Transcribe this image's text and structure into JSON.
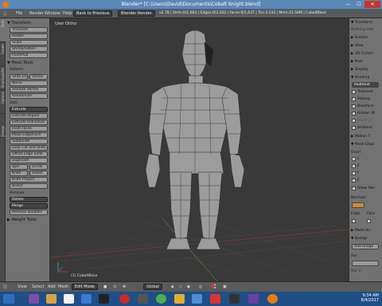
{
  "window": {
    "title": "Blender* [C:\\Users\\David\\Documents\\Cobalt Knight.blend]",
    "min": "—",
    "max": "☐",
    "close": "✕"
  },
  "infobar": {
    "menus": [
      "File",
      "Render",
      "Window",
      "Help"
    ],
    "back": "Back to Previous",
    "engine": "Blender Render",
    "stats": "v2.78 | Verts:0/1,663 | Edges:0/3,302 | Faces:0/1,637 | Tris:3,143 | Mem:21.56M | CobaltBase"
  },
  "left_tabs": [
    "Tools",
    "Create",
    "Shading/UVs",
    "Options",
    "Grease Pencil"
  ],
  "toolshelf": {
    "transform_header": "▼ Transform",
    "transform": [
      "Translate",
      "Rotate",
      "Scale",
      "Shrink/Fatten",
      "Push/Pull"
    ],
    "mesh_tools_header": "▼ Mesh Tools",
    "deform_label": "Deform:",
    "slide": [
      "Slide Ed",
      "Vertex"
    ],
    "deform": [
      "Noise",
      "Smooth Vertex",
      "Randomize"
    ],
    "add_label": "Add:",
    "extrude_select": "Extrude",
    "add": [
      "Extrude Region",
      "Extrude Individual",
      "Inset Faces",
      "Make Edge/Face",
      "Subdivide",
      "Loop Cut and Slide",
      "Offset Edge Slide",
      "Duplicate"
    ],
    "spin_screw": [
      "Spin",
      "Screw"
    ],
    "knife_select": [
      "Knife",
      "Select"
    ],
    "more": [
      "Knife Project",
      "Bisect"
    ],
    "remove_label": "Remove:",
    "delete_select": "Delete",
    "merge_select": "Merge",
    "remove_doubles": "Remove Doubles",
    "weight_tools": "▶ Weight Tools"
  },
  "viewport": {
    "title": "User Ortho",
    "object": "(1) CobaltBase"
  },
  "props": {
    "items": [
      "▼ Transform",
      "Nothing sele",
      "▶ Grease",
      "▶ View",
      "▶ 3D Cursor",
      "▶ Item",
      "▶ Display",
      "▼ Shading"
    ],
    "shading_select": "Multitext",
    "shading_checks": [
      "Textured",
      "Matcap",
      "Backface",
      "Hidden W",
      "Depth O",
      "Ambient"
    ],
    "motion": "▶ Motion T",
    "mesh_display": "▼ Mesh Displ",
    "overlay": "Overl",
    "overlay_checks": [
      "E",
      "E",
      "F",
      "E"
    ],
    "show_wei": "Show Wei",
    "normals": "Normals:",
    "edge_info": [
      "Edge",
      "Face"
    ],
    "mesh_an": "▶ Mesh An",
    "background": "▼ Backgr",
    "add_image": "Add Image",
    "axis": "Axi",
    "hint": "Not S"
  },
  "bottombar": {
    "items": [
      "View",
      "Select",
      "Add",
      "Mesh"
    ],
    "mode": "Edit Mode",
    "pivot": "Global"
  },
  "taskbar": {
    "time": "9:34 AM",
    "date": "8/4/2017"
  },
  "colors": {
    "accent": "#e87d0d",
    "grid_red": "#8a3a3a",
    "grid_green": "#4d7a3a",
    "mesh_fill": "#9c9c9c"
  }
}
